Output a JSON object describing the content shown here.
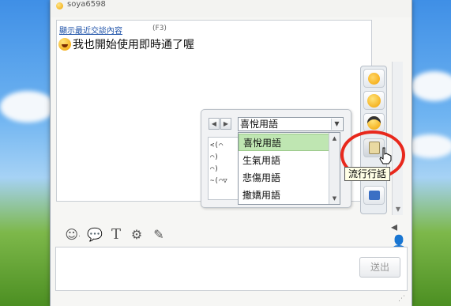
{
  "chat": {
    "contact_name": "soya6598",
    "recent_link": "顯示最近交談內容",
    "recent_shortcut": "(F3)",
    "message": "我也開始使用即時通了喔"
  },
  "emoticon_popup": {
    "selected_category": "喜悅用語",
    "categories": [
      "喜悅用語",
      "生氣用語",
      "悲傷用語",
      "撒嬌用語"
    ],
    "preview_lines": [
      "<(⌒",
      "⌒)",
      "⌒)",
      "~(⌒▽"
    ],
    "tooltip": "流行行話"
  },
  "composer": {
    "send_label": "送出"
  },
  "colors": {
    "highlight": "#e8281c",
    "selected_item": "#bfe6b2",
    "link": "#2255aa"
  }
}
